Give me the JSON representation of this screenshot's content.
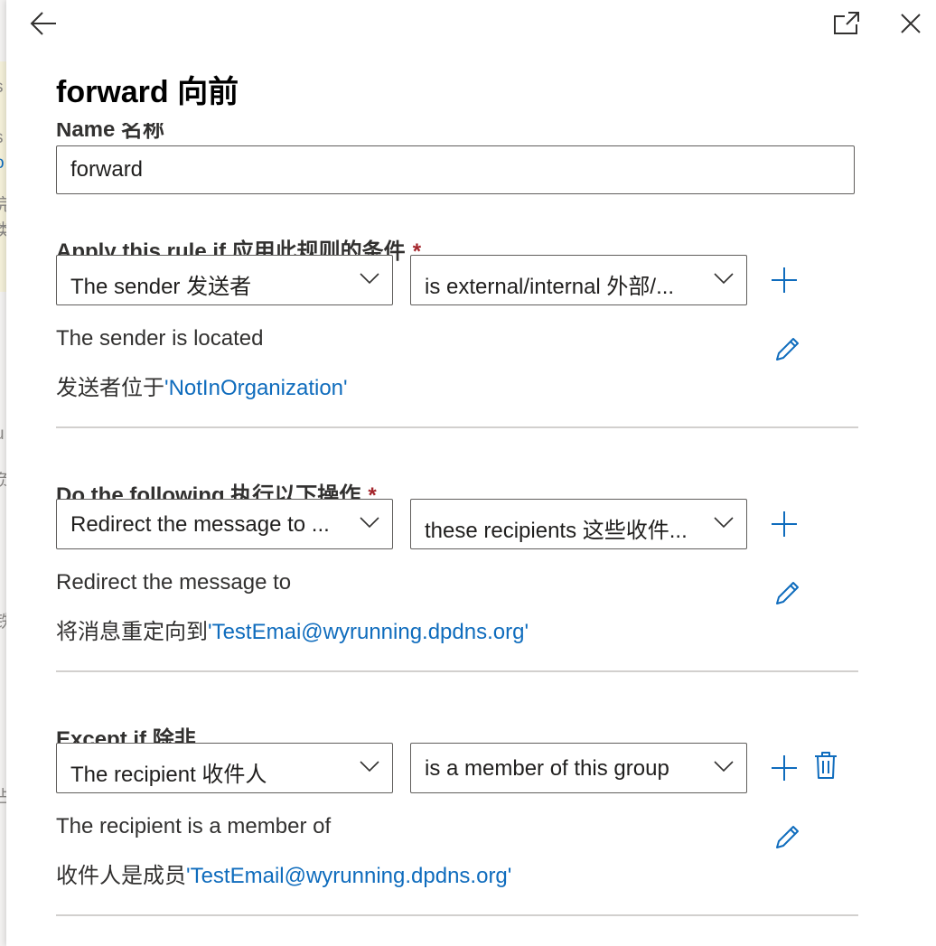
{
  "panel": {
    "title": "forward  向前",
    "name_label": "Name  名称",
    "name_value": "forward"
  },
  "sections": [
    {
      "label": "Apply this rule if  应用此规则的条件",
      "required": "*",
      "dropdown1": "The sender  发送者",
      "dropdown2": "is external/internal  外部/...",
      "desc_line1": "The sender is located",
      "desc_prefix": "发送者位于",
      "desc_value": "'NotInOrganization'"
    },
    {
      "label": "Do the following  执行以下操作",
      "required": "*",
      "dropdown1": "Redirect the message to  ...",
      "dropdown2": "these recipients  这些收件...",
      "desc_line1": "Redirect the message to",
      "desc_prefix": "将消息重定向到",
      "desc_value": "'TestEmai@wyrunning.dpdns.org'"
    },
    {
      "label": "Except if  除非",
      "dropdown1": "The recipient  收件人",
      "dropdown2": "is a member of this group",
      "desc_line1": "The recipient is a member of",
      "desc_prefix": "收件人是成员",
      "desc_value": "'TestEmail@wyrunning.dpdns.org'"
    }
  ],
  "background_fragments": [
    "s",
    "i",
    "s",
    "o",
    "完",
    "类",
    "f",
    "u",
    "负",
    "铁",
    "占"
  ],
  "icons": {
    "back": "arrow-left-icon",
    "popout": "open-in-new-window-icon",
    "close": "close-icon",
    "add": "plus-icon",
    "edit": "pencil-icon",
    "delete": "trash-icon",
    "dropdown": "chevron-down-icon"
  },
  "colors": {
    "accent": "#0f6cbd",
    "required": "#a4262c",
    "border": "#605e5c",
    "divider": "#d2d0ce"
  }
}
